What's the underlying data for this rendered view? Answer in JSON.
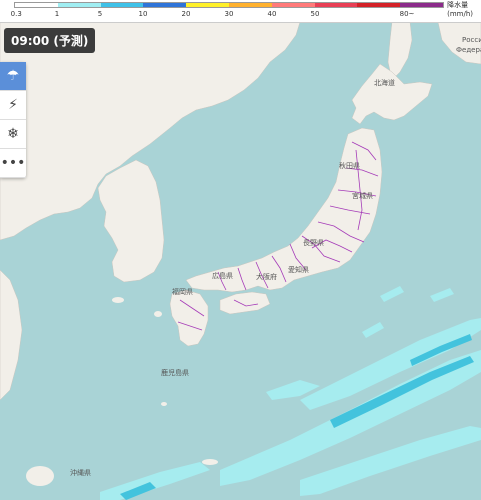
{
  "legend": {
    "title": "降水量",
    "unit": "(mm/h)",
    "ticks": [
      "0.3",
      "1",
      "5",
      "10",
      "20",
      "30",
      "40",
      "50",
      "80~"
    ],
    "colors": [
      "#ffffff",
      "#a0eef2",
      "#3fc1e8",
      "#2f74d8",
      "#fff02a",
      "#ffb12e",
      "#ff7a7a",
      "#e83f55",
      "#d32127",
      "#8b2b8a"
    ]
  },
  "time_label": "09:00 (予測)",
  "tools": [
    {
      "icon": "rain-cloud-icon",
      "glyph": "☂",
      "active": true
    },
    {
      "icon": "lightning-icon",
      "glyph": "⚡",
      "active": false
    },
    {
      "icon": "snowflake-icon",
      "glyph": "❄",
      "active": false
    },
    {
      "icon": "more-icon",
      "glyph": "•••",
      "active": false
    }
  ],
  "map": {
    "labels": {
      "russia_1": "Россия",
      "russia_2": "Федерация",
      "hokkaido": "北海道",
      "akita": "秋田県",
      "miyagi": "宮城県",
      "nagano": "長野県",
      "hiroshima": "広島県",
      "osaka": "大阪府",
      "aichi": "愛知県",
      "fukuoka": "福岡県",
      "kagoshima": "鹿児島県",
      "okinawa": "沖縄県"
    },
    "colors": {
      "sea": "#a9d3d6",
      "land": "#f2efe9",
      "border": "#a53bb8",
      "rain_light": "#a6ecef",
      "rain_mid": "#43c3dd"
    }
  }
}
